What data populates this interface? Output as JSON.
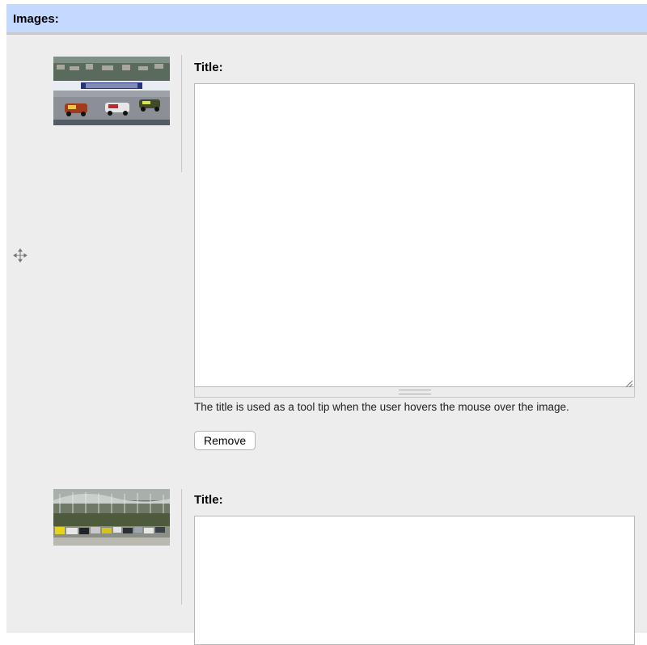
{
  "section": {
    "title": "Images:"
  },
  "images": [
    {
      "title_label": "Title:",
      "title_value": "",
      "help_text": "The title is used as a tool tip when the user hovers the mouse over the image.",
      "remove_label": "Remove",
      "thumbnail_icon": "race-cars-on-track-photo"
    },
    {
      "title_label": "Title:",
      "title_value": "",
      "thumbnail_icon": "race-cars-pack-photo"
    }
  ],
  "drag_icon": "move-arrows-icon"
}
